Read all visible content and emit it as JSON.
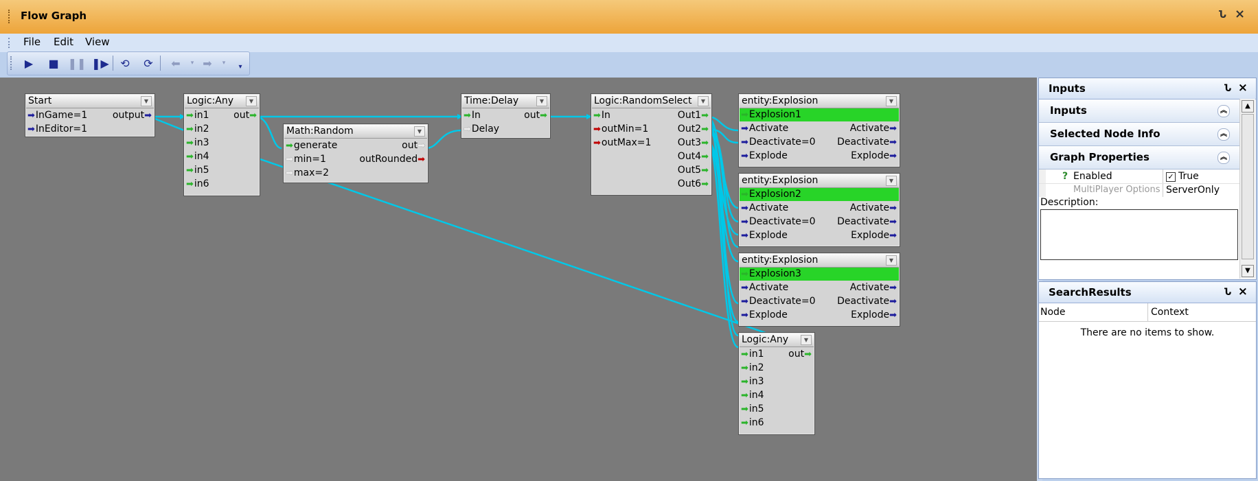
{
  "window": {
    "title": "Flow Graph",
    "pin": "Ն",
    "close": "×"
  },
  "menu": {
    "file": "File",
    "edit": "Edit",
    "view": "View"
  },
  "toolbar": {
    "play": "play-icon",
    "stop": "stop-icon",
    "pause": "pause-icon",
    "step": "step-icon",
    "undo": "undo-icon",
    "redo": "redo-icon",
    "back": "back-arrow-icon",
    "forward": "forward-arrow-icon"
  },
  "nodes": {
    "start": {
      "title": "Start",
      "p1": "InGame=1",
      "p2": "InEditor=1",
      "out": "output"
    },
    "any1": {
      "title": "Logic:Any",
      "in1": "in1",
      "in2": "in2",
      "in3": "in3",
      "in4": "in4",
      "in5": "in5",
      "in6": "in6",
      "out": "out"
    },
    "random": {
      "title": "Math:Random",
      "gen": "generate",
      "min": "min=1",
      "max": "max=2",
      "out": "out",
      "outr": "outRounded"
    },
    "delay": {
      "title": "Time:Delay",
      "in": "In",
      "delay": "Delay",
      "out": "out"
    },
    "rsel": {
      "title": "Logic:RandomSelect",
      "in": "In",
      "omin": "outMin=1",
      "omax": "outMax=1",
      "o1": "Out1",
      "o2": "Out2",
      "o3": "Out3",
      "o4": "Out4",
      "o5": "Out5",
      "o6": "Out6"
    },
    "exp1": {
      "title": "entity:Explosion",
      "ent": "Explosion1",
      "act": "Activate",
      "deact": "Deactivate=0",
      "expl": "Explode",
      "oact": "Activate",
      "odeact": "Deactivate",
      "oexpl": "Explode"
    },
    "exp2": {
      "title": "entity:Explosion",
      "ent": "Explosion2",
      "act": "Activate",
      "deact": "Deactivate=0",
      "expl": "Explode",
      "oact": "Activate",
      "odeact": "Deactivate",
      "oexpl": "Explode"
    },
    "exp3": {
      "title": "entity:Explosion",
      "ent": "Explosion3",
      "act": "Activate",
      "deact": "Deactivate=0",
      "expl": "Explode",
      "oact": "Activate",
      "odeact": "Deactivate",
      "oexpl": "Explode"
    },
    "any2": {
      "title": "Logic:Any",
      "in1": "in1",
      "in2": "in2",
      "in3": "in3",
      "in4": "in4",
      "in5": "in5",
      "in6": "in6",
      "out": "out"
    }
  },
  "inputs_panel": {
    "title": "Inputs",
    "sections": {
      "inputs": "Inputs",
      "selected": "Selected Node Info",
      "graph": "Graph Properties"
    },
    "props": {
      "q": "?",
      "enabled_label": "Enabled",
      "enabled_value": "True",
      "mp_label": "MultiPlayer Options",
      "mp_value": "ServerOnly"
    },
    "description_label": "Description:"
  },
  "search_panel": {
    "title": "SearchResults",
    "col_node": "Node",
    "col_context": "Context",
    "empty": "There are no items to show."
  },
  "colors": {
    "wire": "#00c8e8",
    "canvas": "#7a7a7a",
    "entity": "#28d428",
    "title_bar": "#eda43a"
  }
}
